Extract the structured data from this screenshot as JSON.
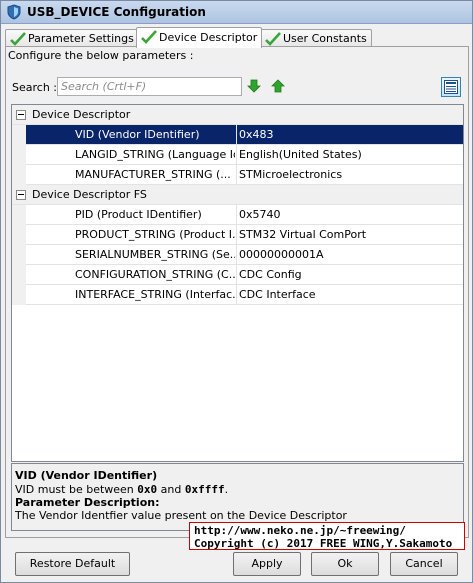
{
  "window": {
    "title": "USB_DEVICE Configuration"
  },
  "tabs": [
    {
      "label": "Parameter Settings",
      "icon": "check-icon",
      "active": false
    },
    {
      "label": "Device Descriptor",
      "icon": "check-icon",
      "active": true
    },
    {
      "label": "User Constants",
      "icon": "check-icon",
      "active": false
    }
  ],
  "main": {
    "configure_label": "Configure the below parameters :",
    "search_label": "Search :",
    "search_placeholder": "Search (Crtl+F)",
    "search_value": ""
  },
  "grid": {
    "categories": [
      {
        "label": "Device Descriptor",
        "rows": [
          {
            "name": "VID (Vendor IDentifier)",
            "value": "0x483",
            "selected": true
          },
          {
            "name": "LANGID_STRING (Language Id...",
            "value": "English(United States)"
          },
          {
            "name": "MANUFACTURER_STRING (...",
            "value": "STMicroelectronics"
          }
        ]
      },
      {
        "label": "Device Descriptor FS",
        "rows": [
          {
            "name": "PID (Product IDentifier)",
            "value": "0x5740"
          },
          {
            "name": "PRODUCT_STRING (Product I...",
            "value": "STM32 Virtual ComPort"
          },
          {
            "name": "SERIALNUMBER_STRING (Se...",
            "value": "00000000001A"
          },
          {
            "name": "CONFIGURATION_STRING (C...",
            "value": "CDC Config"
          },
          {
            "name": "INTERFACE_STRING (Interfac...",
            "value": "CDC Interface"
          }
        ]
      }
    ]
  },
  "description": {
    "title": "VID (Vendor IDentifier)",
    "line1_prefix": "VID must be between ",
    "line1_min": "0x0",
    "line1_and": " and ",
    "line1_max": "0xffff",
    "line1_suffix": ".",
    "param_heading": "Parameter Description:",
    "param_text": "The Vendor Identfier value present on the Device Descriptor"
  },
  "watermark": {
    "line1": "http://www.neko.ne.jp/~freewing/",
    "line2": "Copyright (c) 2017 FREE WING,Y.Sakamoto"
  },
  "buttons": {
    "restore": "Restore Default",
    "apply": "Apply",
    "ok": "Ok",
    "cancel": "Cancel"
  },
  "colors": {
    "selection": "#0a246a",
    "check": "#3aa53a",
    "arrow_green": "#2fa52f"
  }
}
